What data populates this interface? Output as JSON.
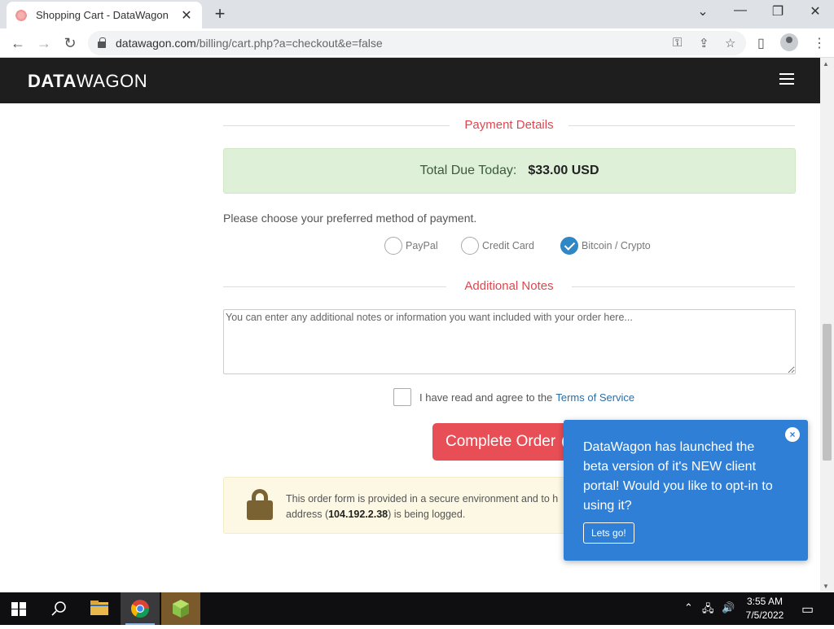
{
  "browser": {
    "tab_title": "Shopping Cart - DataWagon",
    "url_host": "datawagon.com",
    "url_path": "/billing/cart.php?a=checkout&e=false"
  },
  "site": {
    "brand_bold": "DATA",
    "brand_light": "WAGON"
  },
  "payment": {
    "section_title": "Payment Details",
    "total_label": "Total Due Today:",
    "total_amount": "$33.00 USD",
    "choose_text": "Please choose your preferred method of payment.",
    "methods": [
      {
        "label": "PayPal",
        "checked": false
      },
      {
        "label": "Credit Card",
        "checked": false
      },
      {
        "label": "Bitcoin / Crypto",
        "checked": true
      }
    ]
  },
  "notes": {
    "section_title": "Additional Notes",
    "placeholder": "You can enter any additional notes or information you want included with your order here..."
  },
  "tos": {
    "text": "I have read and agree to the",
    "link": "Terms of Service"
  },
  "complete_order": {
    "label": "Complete Order"
  },
  "secure": {
    "text_a": "This order form is provided in a secure environment and to h",
    "text_b": "address (",
    "ip": "104.192.2.38",
    "text_c": ") is being logged."
  },
  "popup": {
    "message": "DataWagon has launched the beta version of it's NEW client portal! Would you like to opt-in to using it?",
    "button": "Lets go!",
    "close": "×"
  },
  "taskbar": {
    "time": "3:55 AM",
    "date": "7/5/2022"
  },
  "colors": {
    "accent_red": "#e84e55",
    "popup_blue": "#2f7fd6",
    "header_dark": "#1e1e1e",
    "success_bg": "#dff0d8"
  }
}
